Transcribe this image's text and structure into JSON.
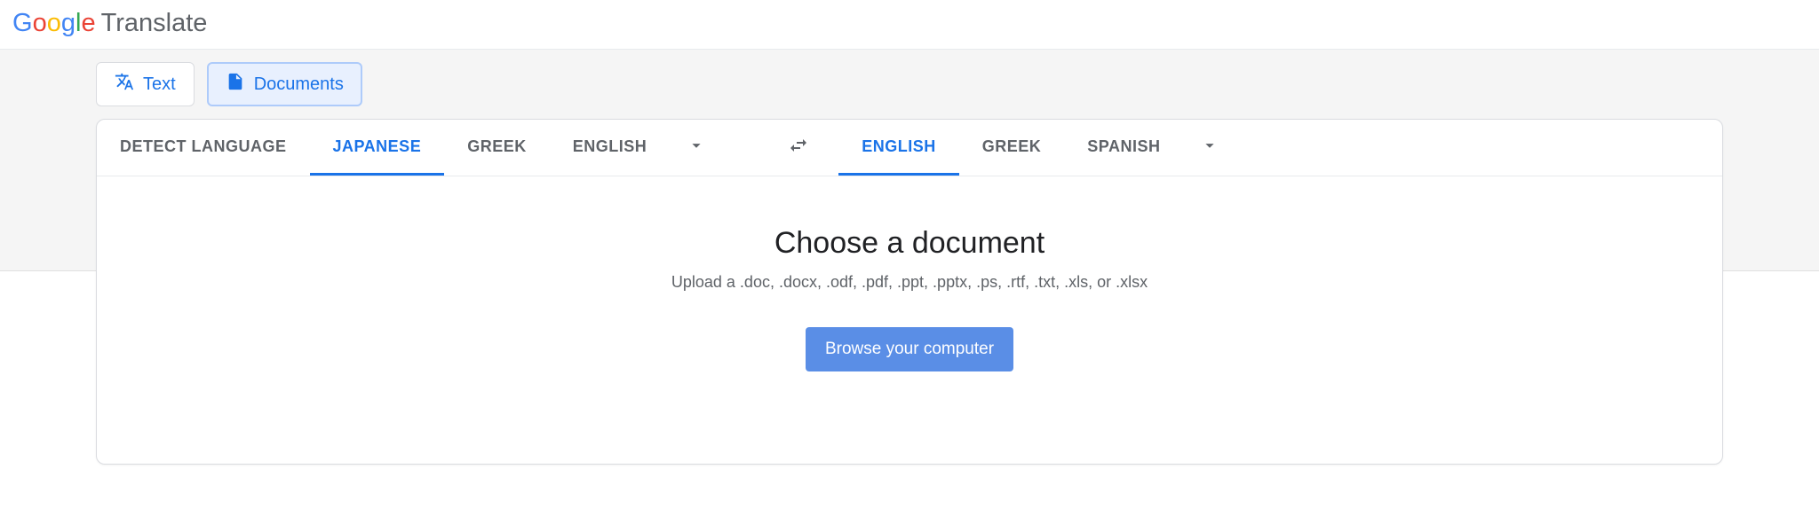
{
  "header": {
    "logo_letters": [
      "G",
      "o",
      "o",
      "g",
      "l",
      "e"
    ],
    "product": "Translate"
  },
  "modes": {
    "text": "Text",
    "documents": "Documents"
  },
  "source": {
    "detect": "DETECT LANGUAGE",
    "l1": "JAPANESE",
    "l2": "GREEK",
    "l3": "ENGLISH"
  },
  "target": {
    "l1": "ENGLISH",
    "l2": "GREEK",
    "l3": "SPANISH"
  },
  "doc": {
    "title": "Choose a document",
    "subtitle": "Upload a .doc, .docx, .odf, .pdf, .ppt, .pptx, .ps, .rtf, .txt, .xls, or .xlsx",
    "browse": "Browse your computer"
  }
}
